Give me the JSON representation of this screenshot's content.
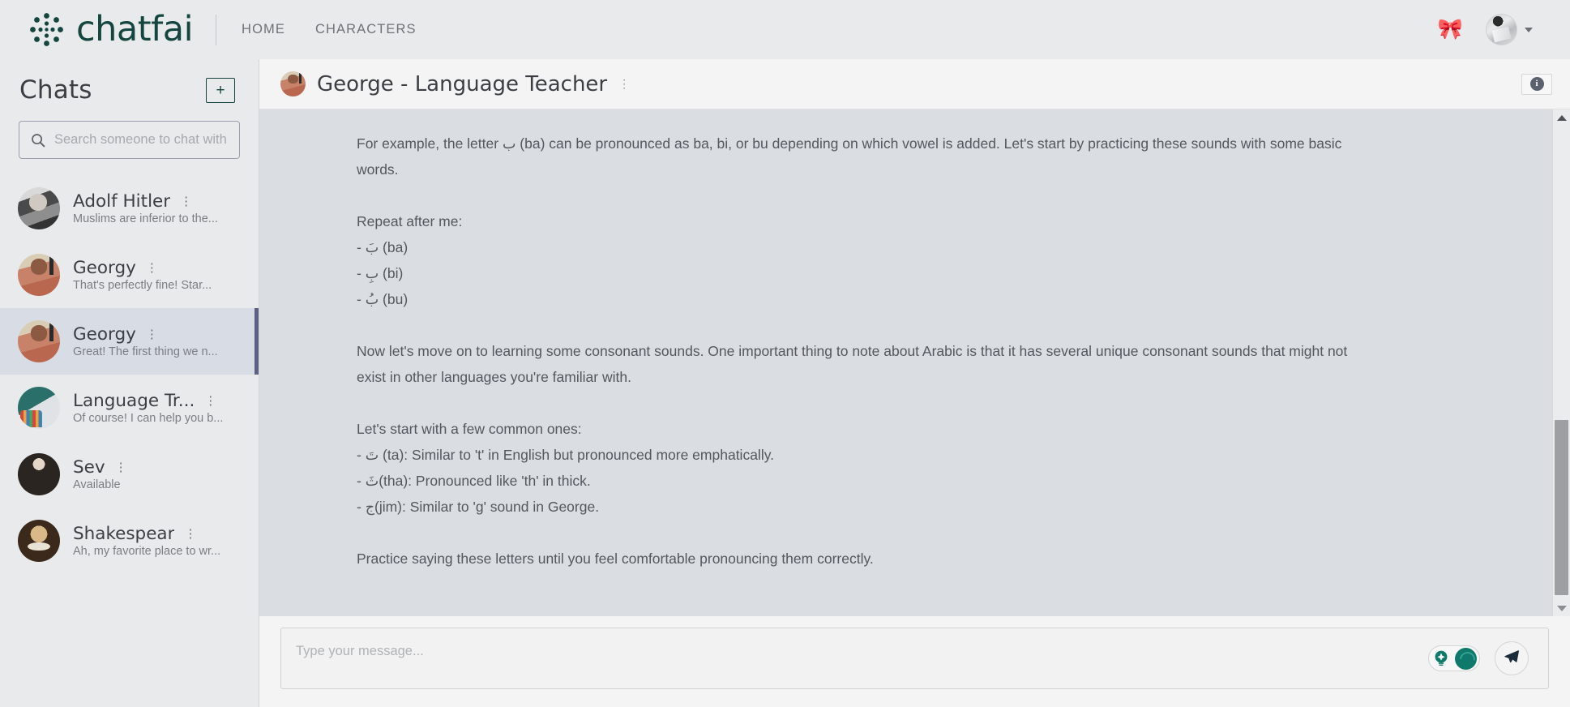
{
  "topnav": {
    "brand_name": "chatfai",
    "brand_icon": "dotted-circle-logo-icon",
    "links": [
      {
        "label": "HOME",
        "name": "nav-link-home"
      },
      {
        "label": "CHARACTERS",
        "name": "nav-link-characters"
      }
    ],
    "ribbon_icon": "🎀",
    "avatar_icon": "user-avatar",
    "chevron_icon": "chevron-down-icon"
  },
  "sidebar": {
    "title": "Chats",
    "add_button_label": "+",
    "search": {
      "placeholder": "Search someone to chat with",
      "value": "",
      "icon": "search-icon"
    },
    "menu_icon": "⋮",
    "items": [
      {
        "name": "Adolf Hitler",
        "preview": "Muslims are inferior to the...",
        "active": false,
        "avatar": "av-hitler"
      },
      {
        "name": "Georgy",
        "preview": "That's perfectly fine! Star...",
        "active": false,
        "avatar": "av-georgy"
      },
      {
        "name": "Georgy",
        "preview": "Great! The first thing we n...",
        "active": true,
        "avatar": "av-georgy"
      },
      {
        "name": "Language Tr...",
        "preview": "Of course! I can help you b...",
        "active": false,
        "avatar": "av-lang"
      },
      {
        "name": "Sev",
        "preview": "Available",
        "active": false,
        "avatar": "av-sev"
      },
      {
        "name": "Shakespear",
        "preview": "Ah, my favorite place to wr...",
        "active": false,
        "avatar": "av-shake"
      }
    ]
  },
  "chat": {
    "title": "George - Language Teacher",
    "title_menu_icon": "⋮",
    "info_button_icon": "i",
    "avatar": "av-georgy",
    "messages": [
      "For example, the letter ب (ba) can be pronounced as ba, bi, or bu depending on which vowel is added. Let's start by practicing these sounds with some basic words.",
      "Repeat after me:",
      "- بَ (ba)",
      "- بِ (bi)",
      "- بُ (bu)",
      "Now let's move on to learning some consonant sounds. One important thing to note about Arabic is that it has several unique consonant sounds that might not exist in other languages you're familiar with.",
      "Let's start with a few common ones:",
      "- تَ (ta): Similar to 't' in English but pronounced more emphatically.",
      "- ثَ(tha): Pronounced like 'th' in thick.",
      "- ج(jim): Similar to 'g' sound in George.",
      "Practice saying these letters until you feel comfortable pronouncing them correctly."
    ],
    "scrollbar": {
      "up_icon": "scroll-up-arrow",
      "down_icon": "scroll-down-arrow"
    }
  },
  "composer": {
    "placeholder": "Type your message...",
    "value": "",
    "idea_toggle_icon": "lightbulb-icon",
    "idea_toggle_state": "on",
    "send_icon": "send-paper-plane-icon"
  },
  "colors": {
    "brand": "#14453f",
    "accent_bar": "#5c6183",
    "toggle_on": "#0f7a6b",
    "nav_bg": "#e8eaec",
    "messages_bg": "#dadde2"
  }
}
